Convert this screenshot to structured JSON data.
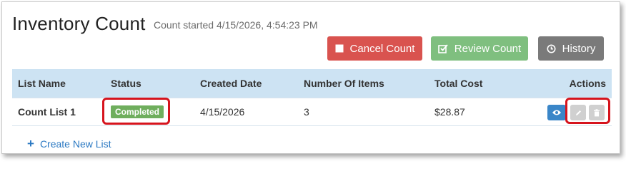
{
  "header": {
    "title": "Inventory Count",
    "subtitle": "Count started 4/15/2026, 4:54:23 PM"
  },
  "toolbar": {
    "cancel_label": "Cancel Count",
    "review_label": "Review Count",
    "history_label": "History"
  },
  "table": {
    "columns": [
      "List Name",
      "Status",
      "Created Date",
      "Number Of Items",
      "Total Cost",
      "Actions"
    ],
    "rows": [
      {
        "name": "Count List 1",
        "status": "Completed",
        "created": "4/15/2026",
        "items": "3",
        "cost": "$28.87"
      }
    ]
  },
  "create_label": "Create New List",
  "icons": {
    "cancel": "square-icon",
    "review": "edit-check-icon",
    "history": "clock-icon",
    "view": "eye-icon",
    "edit": "pencil-icon",
    "delete": "trash-icon",
    "create": "plus-icon"
  },
  "colors": {
    "cancel": "#d9534f",
    "review": "#7fbf7f",
    "history": "#7a7a7a",
    "table_header": "#cde3f3",
    "badge": "#6fae5d",
    "highlight": "#d6141d",
    "view": "#3a86c8",
    "link": "#2a78c2"
  }
}
